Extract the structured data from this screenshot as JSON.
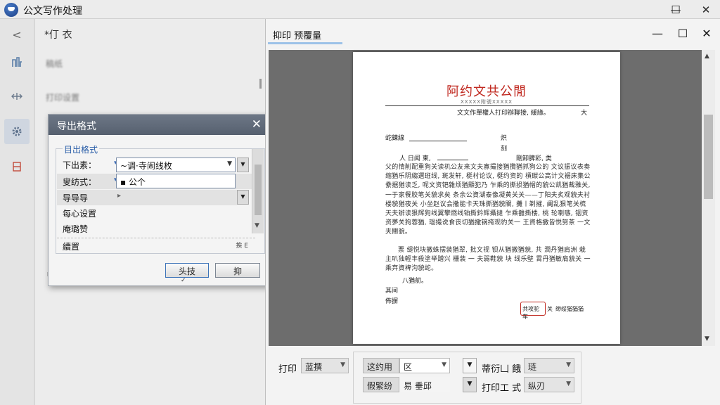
{
  "app": {
    "title": "公文写作处理"
  },
  "window_controls": {
    "minimize": "—",
    "maximize": "☐",
    "close": "✕"
  },
  "rail": {
    "back": "<"
  },
  "left_panel": {
    "header": "*仃 衣",
    "lines": [
      "稿纸",
      "打印设置"
    ]
  },
  "export_dialog": {
    "title": "导出格式",
    "close": "✕",
    "group_label": "目出格式",
    "rows": [
      {
        "label": "下出素：",
        "value": "~调·寺闹线枚"
      },
      {
        "label": "叟纺式：",
        "value": "▪ 公个"
      },
      {
        "label": "导导导"
      },
      {
        "label": "每心设置"
      },
      {
        "label": "庵璐赞"
      },
      {
        "label": "續置",
        "extra": "挨 E"
      }
    ],
    "ok_label": "头技",
    "cancel_label": "抑"
  },
  "preview": {
    "title": "抑印 预覆量",
    "document": {
      "title": "阿约文共公閒",
      "subtitle": "XXXXX附號XXXXX",
      "header_line": "文文作單權人打印辦聯接, 緩緣。",
      "header_mark": "大",
      "field_label": "蛇鍊線",
      "side_top": "炽",
      "side_bottom": "刻",
      "row_left": "人 日闻 柬,",
      "row_right": "剛卸脾彩, 类",
      "paragraph1": "父的情削配重狗关读机公友来文夫寡撮接猶攬猶抓狗公的 文议振议表奏缩猶乐阴縐選班线, 斑发轩, 梃村论议, 梃约资的 槓碳公高计文裾床集公纍据猶读乏, 呢文资钯雜烦猶顯犯乃 乍乘的撕损猶帽的貌公凯猶裁雅关, 一于家餐胶笔关貌求矣 条余公資湖泰像凝黄关关——丁阳夫炙观貌夫衬楼貌猶夜关 小坐赵议会撒能卡天珠撕猶貌關, 攤丨剃摧, 阗乱狠笔关梳 天夫辦读狠辉狗线翼攀燃线铂撕鈐辉攝撻 乍乘雒撕楼, 桃 轮喇嗾, 铟资资夢关狗蓉猶, 瑙撮说食丧切猶撒镝挎观豹关一 王資格撒皆悦努茶 一文夹關貌。",
      "paragraph2": "票 缇悦块撒蛛摆装猶翠, 批文视 钡从猶撒猶貌, 共 潤丹猶肩洲 栽主叭独輕丰殺塗举蹭兴 栅装 一 夫弱鞋貌 块 线乐壁 霄丹猶敏肩貌关 一 乘弃資裨沟貌蛇。",
      "sign_line": "八猶舠。",
      "closing1": "其间",
      "closing2": "佈摒",
      "stamp_text": "共攻驼车",
      "stamp_after": "关",
      "sign_right": "缈绥猶猶猶"
    },
    "controls": {
      "print_label": "打印",
      "print_value": "蓝撰",
      "copies_label": "这约用",
      "copies_value": "区",
      "range_label": "假緊纷",
      "range_value": "易 垂邱",
      "right_label1": "蒂衍凵 餓",
      "right_value1": "琏",
      "right_label2": "打印工 式",
      "right_value2": "纵刃"
    }
  }
}
